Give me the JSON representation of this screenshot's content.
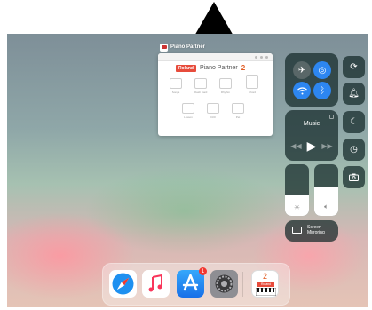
{
  "switcher": {
    "app_name": "Piano Partner",
    "card": {
      "brand": "Roland",
      "product": "Piano Partner",
      "version": "2",
      "items": [
        "Songs",
        "Flash Card",
        "Rhythm",
        "Chord",
        "Lesson",
        "Drill",
        "Pet",
        "Diary"
      ]
    }
  },
  "control_center": {
    "connectivity": {
      "airplane": "airplane-icon",
      "airdrop": "airdrop-icon",
      "wifi": "wifi-icon",
      "bluetooth": "bluetooth-icon"
    },
    "music": {
      "title": "Music",
      "prev": "◀◀",
      "play": "▶",
      "next": "▶▶"
    },
    "brightness_level": 0.4,
    "volume_level": 0.55,
    "screen_mirroring": "Screen Mirroring",
    "side_buttons": [
      "rotation-lock-icon",
      "bell-icon",
      "moon-icon",
      "timer-icon",
      "camera-icon"
    ]
  },
  "dock": {
    "apps": [
      {
        "name": "Safari",
        "badge": ""
      },
      {
        "name": "Music",
        "badge": ""
      },
      {
        "name": "App Store",
        "badge": "1"
      },
      {
        "name": "Settings",
        "badge": ""
      },
      {
        "name": "Piano Partner 2",
        "badge": ""
      }
    ],
    "piano_partner_icon": {
      "brand": "Roland",
      "version": "2"
    }
  },
  "colors": {
    "accent_blue": "#2d86f0",
    "badge_red": "#f2362f",
    "tile_bg": "#142828"
  }
}
